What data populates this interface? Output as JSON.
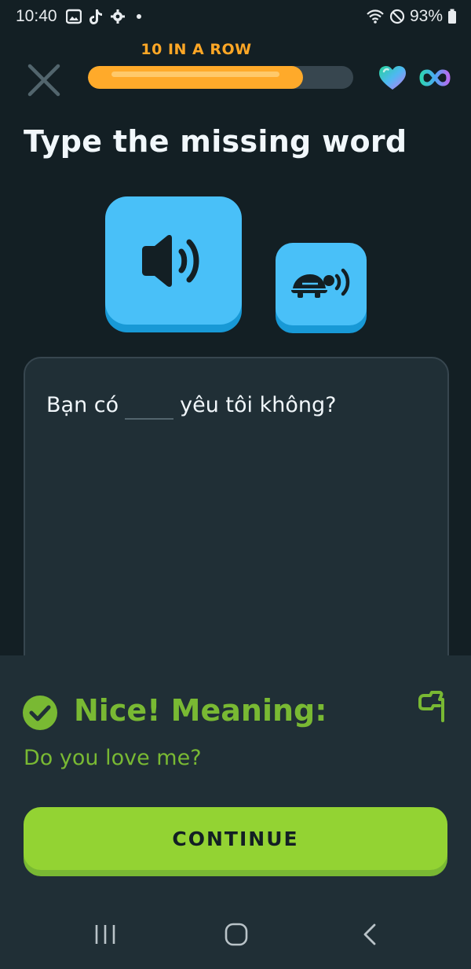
{
  "status": {
    "time": "10:40",
    "battery": "93%"
  },
  "streak": {
    "label": "10 IN A ROW",
    "progress": 0.81
  },
  "title": "Type the missing word",
  "exercise": {
    "sentence_before": "Bạn có",
    "sentence_after": "yêu tôi không?"
  },
  "feedback": {
    "title": "Nice! Meaning:",
    "meaning": "Do you love me?",
    "continue_label": "CONTINUE"
  },
  "colors": {
    "background": "#131f24",
    "accent_blue": "#49c0f8",
    "success_green": "#93d333",
    "streak_orange": "#ffaa2a"
  },
  "icons": {
    "close": "close-icon",
    "hearts": "heart-icon",
    "infinity": "infinity-icon",
    "speaker": "speaker-icon",
    "slow_audio": "turtle-icon",
    "success": "check-circle-icon",
    "report": "flag-icon"
  }
}
